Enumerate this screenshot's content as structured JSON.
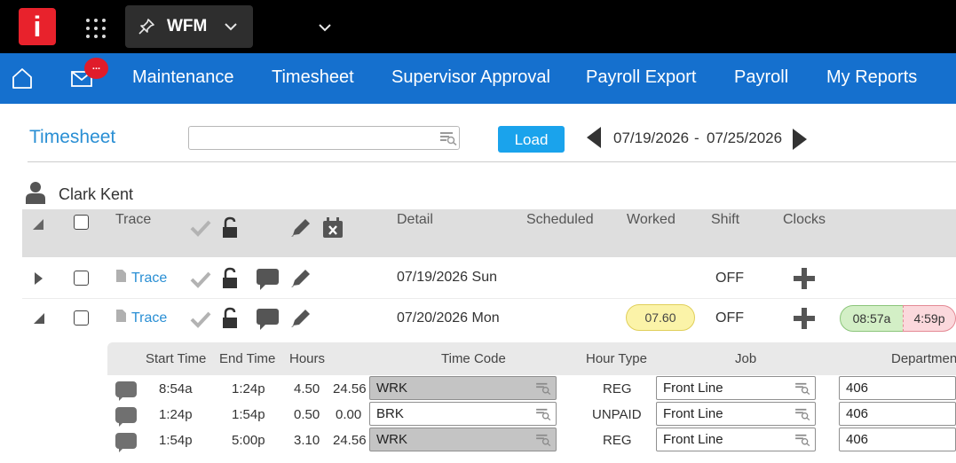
{
  "topbar": {
    "logo_text": "i",
    "app_name": "WFM",
    "icons": [
      "grid-icon",
      "pin-icon",
      "chevron-down-icon"
    ]
  },
  "nav": {
    "badge": "...",
    "items": [
      "Maintenance",
      "Timesheet",
      "Supervisor Approval",
      "Payroll Export",
      "Payroll",
      "My Reports"
    ]
  },
  "page": {
    "title": "Timesheet",
    "search_value": "",
    "load_label": "Load",
    "date_from": "07/19/2026",
    "date_sep": "-",
    "date_to": "07/25/2026"
  },
  "employee": {
    "name": "Clark Kent"
  },
  "table": {
    "headers": [
      "Trace",
      "Detail",
      "Scheduled",
      "Worked",
      "Shift",
      "Clocks"
    ],
    "rows": [
      {
        "trace": "Trace",
        "detail": "07/19/2026 Sun",
        "worked": "",
        "shift": "OFF",
        "clock_in": "",
        "clock_out": ""
      },
      {
        "trace": "Trace",
        "detail": "07/20/2026 Mon",
        "worked": "07.60",
        "shift": "OFF",
        "clock_in": "08:57a",
        "clock_out": "4:59p"
      }
    ]
  },
  "details": {
    "headers": [
      "Start Time",
      "End Time",
      "Hours",
      "Time Code",
      "Hour Type",
      "Job",
      "Department"
    ],
    "rows": [
      {
        "start": "8:54a",
        "end": "1:24p",
        "hours": "4.50",
        "rate": "24.56",
        "code": "WRK",
        "type": "REG",
        "job": "Front Line",
        "dept": "406"
      },
      {
        "start": "1:24p",
        "end": "1:54p",
        "hours": "0.50",
        "rate": "0.00",
        "code": "BRK",
        "type": "UNPAID",
        "job": "Front Line",
        "dept": "406"
      },
      {
        "start": "1:54p",
        "end": "5:00p",
        "hours": "3.10",
        "rate": "24.56",
        "code": "WRK",
        "type": "REG",
        "job": "Front Line",
        "dept": "406"
      }
    ]
  },
  "colors": {
    "nav_bg": "#1570ce",
    "accent": "#2a8fd4",
    "load_button": "#1aa3ec",
    "logo": "#e8222c",
    "worked_pill": "#fbf3a8",
    "clock_in": "#d3efc6",
    "clock_out": "#fbd8dc"
  }
}
